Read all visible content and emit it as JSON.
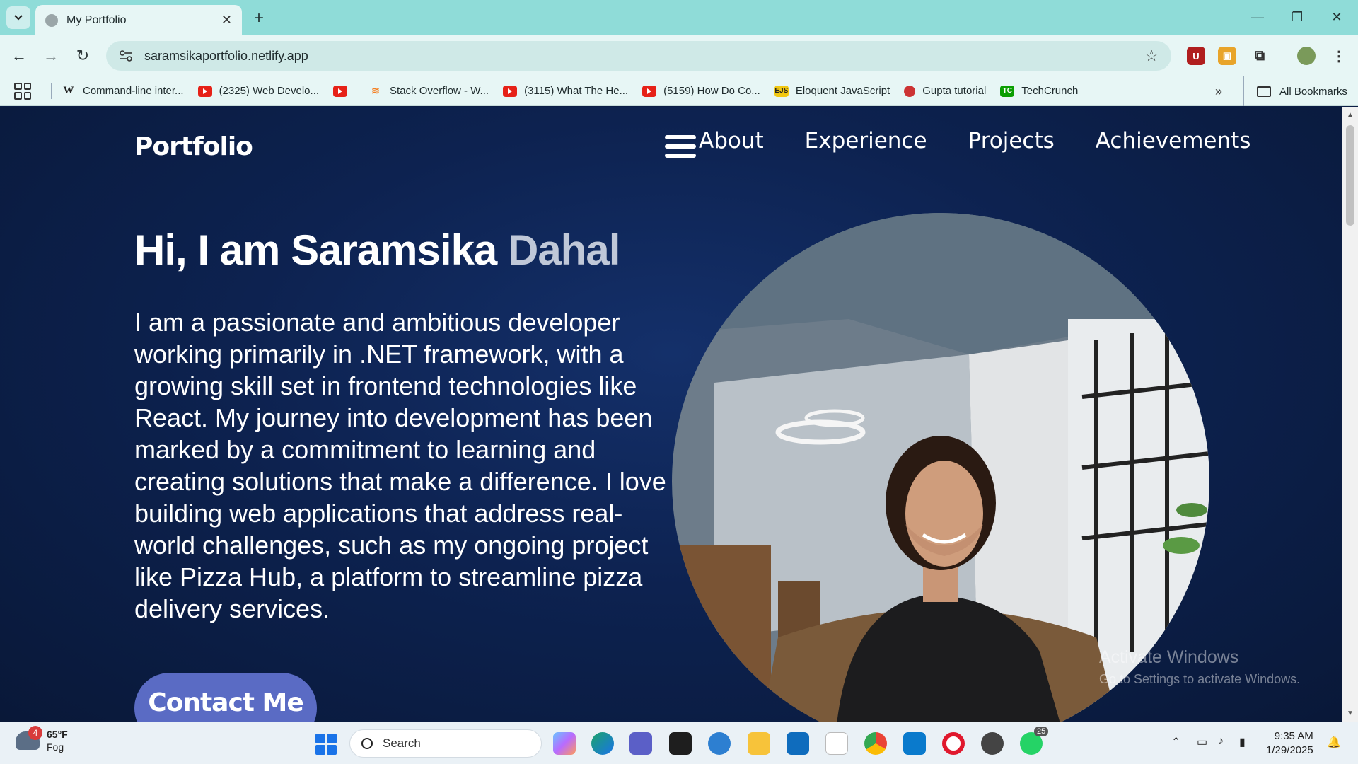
{
  "browser": {
    "tab_title": "My Portfolio",
    "url": "saramsikaportfolio.netlify.app",
    "bookmarks": [
      {
        "label": "Command-line inter...",
        "icon": "wikipedia-icon"
      },
      {
        "label": "(2325) Web Develo...",
        "icon": "youtube-icon"
      },
      {
        "label": "",
        "icon": "youtube-icon"
      },
      {
        "label": "Stack Overflow - W...",
        "icon": "stackoverflow-icon"
      },
      {
        "label": "(3115) What The He...",
        "icon": "youtube-icon"
      },
      {
        "label": "(5159) How Do Co...",
        "icon": "youtube-icon"
      },
      {
        "label": "Eloquent JavaScript",
        "icon": "ejs-icon"
      },
      {
        "label": "Gupta tutorial",
        "icon": "gupta-icon"
      },
      {
        "label": "TechCrunch",
        "icon": "techcrunch-icon"
      }
    ],
    "all_bookmarks": "All Bookmarks",
    "more_label": "»"
  },
  "page": {
    "logo": "Portfolio",
    "nav": [
      "About",
      "Experience",
      "Projects",
      "Achievements"
    ],
    "hero_greeting": "Hi, I am Saramsika ",
    "hero_surname": "Dahal",
    "hero_text": "I am a passionate and ambitious developer working primarily in .NET framework, with a growing skill set in frontend technologies like React. My journey into development has been marked by a commitment to learning and creating solutions that make a difference. I love building web applications that address real-world challenges, such as my ongoing project like Pizza Hub, a platform to streamline pizza delivery services.",
    "contact_button": "Contact Me",
    "colors": {
      "background": "#0b1d45",
      "accent": "#5a6bc4",
      "surname": "#c0c8d8"
    }
  },
  "watermark": {
    "line1": "Activate Windows",
    "line2": "Go to Settings to activate Windows."
  },
  "taskbar": {
    "weather_badge": "4",
    "temperature": "65°F",
    "condition": "Fog",
    "search_label": "Search",
    "whatsapp_badge": "25",
    "time": "9:35 AM",
    "date": "1/29/2025"
  }
}
